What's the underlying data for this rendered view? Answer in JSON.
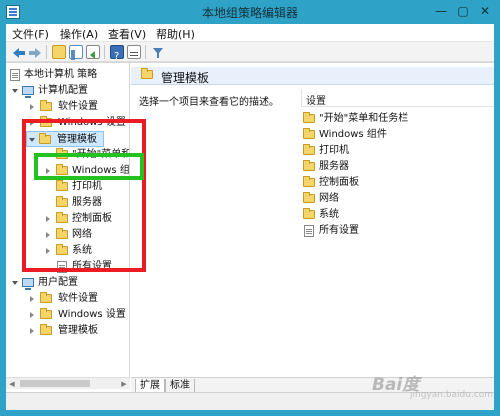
{
  "window": {
    "title": "本地组策略编辑器",
    "minimize": "—",
    "maximize": "▢",
    "close": "✕"
  },
  "menu": [
    "文件(F)",
    "操作(A)",
    "查看(V)",
    "帮助(H)"
  ],
  "tree": {
    "root": "本地计算机 策略",
    "computer_config": "计算机配置",
    "computer_software": "软件设置",
    "computer_windows": "Windows 设置",
    "admin_templates": "管理模板",
    "start_menu": "\"开始\"菜单和",
    "windows_components": "Windows 组件",
    "printers": "打印机",
    "servers": "服务器",
    "control_panel": "控制面板",
    "network": "网络",
    "system": "系统",
    "all_settings": "所有设置",
    "user_config": "用户配置",
    "user_software": "软件设置",
    "user_windows": "Windows 设置",
    "user_admin_templates": "管理模板"
  },
  "details": {
    "title": "管理模板",
    "description": "选择一个项目来查看它的描述。",
    "column": "设置",
    "items": [
      "\"开始\"菜单和任务栏",
      "Windows 组件",
      "打印机",
      "服务器",
      "控制面板",
      "网络",
      "系统",
      "所有设置"
    ]
  },
  "tabs": {
    "extended": "扩展",
    "standard": "标准"
  },
  "watermark": {
    "main": "Bai度",
    "sub": "jingyan.baidu.com"
  }
}
